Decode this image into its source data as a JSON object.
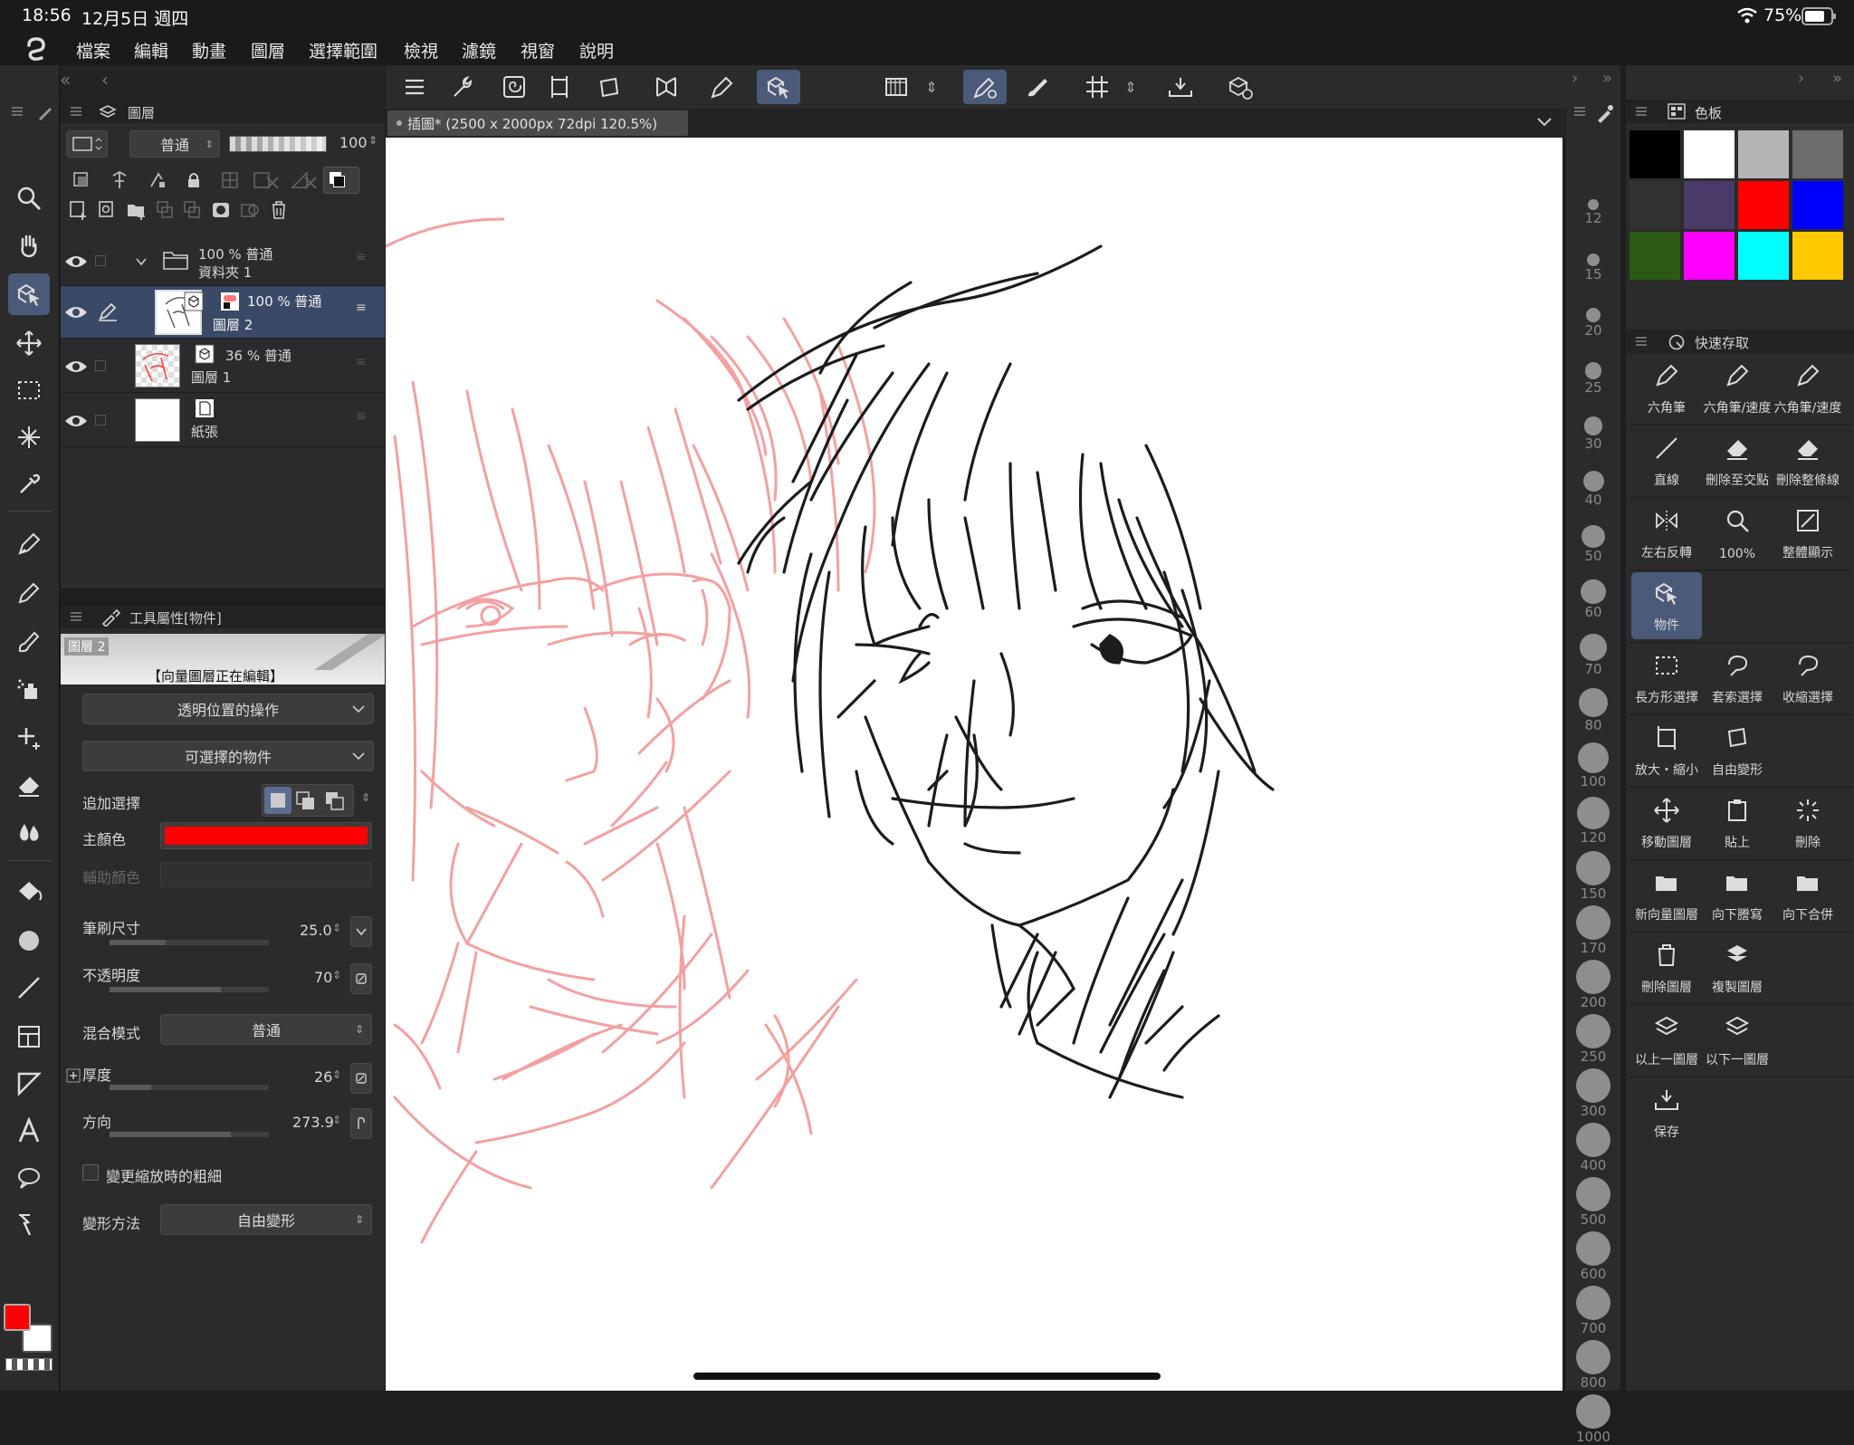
{
  "status": {
    "time": "18:56",
    "date": "12月5日 週四",
    "battery": "75%"
  },
  "menu": [
    "檔案",
    "編輯",
    "動畫",
    "圖層",
    "選擇範圍",
    "檢視",
    "濾鏡",
    "視窗",
    "說明"
  ],
  "layer_panel": {
    "title": "圖層",
    "blend_mode": "普通",
    "opacity": "100",
    "opacity_fraction": 1.0,
    "layers": [
      {
        "line1": "100 % 普通",
        "line2": "資料夾 1"
      },
      {
        "line1": "100 % 普通",
        "line2": "圖層 2"
      },
      {
        "line1": "36 % 普通",
        "line2": "圖層 1"
      },
      {
        "line1": "",
        "line2": "紙張"
      }
    ]
  },
  "tool_props": {
    "title": "工具屬性[物件]",
    "preview_layer": "圖層 2",
    "preview_caption": "【向量圖層正在編輯】",
    "dropdown1": "透明位置的操作",
    "dropdown2": "可選擇的物件",
    "add_select_label": "追加選擇",
    "main_color_label": "主顏色",
    "main_color": "#ff0000",
    "sub_color_label": "輔助顏色",
    "brush_size_label": "筆刷尺寸",
    "brush_size": "25.0",
    "brush_size_fraction": 0.35,
    "opacity_label": "不透明度",
    "opacity": "70",
    "opacity_fraction": 0.7,
    "blend_label": "混合模式",
    "blend": "普通",
    "thickness_label": "厚度",
    "thickness": "26",
    "thickness_fraction": 0.26,
    "direction_label": "方向",
    "direction": "273.9",
    "direction_fraction": 0.76,
    "checkbox_label": "變更縮放時的粗細",
    "transform_label": "變形方法",
    "transform": "自由變形"
  },
  "document_tab": "插圖* (2500 x 2000px 72dpi 120.5%)",
  "brush_sizes": [
    "12",
    "15",
    "20",
    "25",
    "30",
    "40",
    "50",
    "60",
    "70",
    "80",
    "100",
    "120",
    "150",
    "170",
    "200",
    "250",
    "300",
    "400",
    "500",
    "600",
    "700",
    "800",
    "1000"
  ],
  "color_set": {
    "title": "色板",
    "colors": [
      "#000000",
      "#ffffff",
      "#b4b4b4",
      "#6c6c6c",
      "#323232",
      "#4a3a6a",
      "#ff0000",
      "#0000ff",
      "#2b5a14",
      "#ff00ff",
      "#00ffff",
      "#ffc800"
    ]
  },
  "quick_access": {
    "title": "快速存取",
    "items": [
      "六角筆",
      "六角筆/速度",
      "六角筆/速度",
      "直線",
      "刪除至交點",
      "刪除整條線",
      "左右反轉",
      "100%",
      "整體顯示",
      "物件",
      "",
      "",
      "長方形選擇",
      "套索選擇",
      "收縮選擇",
      "放大・縮小",
      "自由變形",
      "",
      "移動圖層",
      "貼上",
      "刪除",
      "新向量圖層",
      "向下謄寫",
      "向下合併",
      "刪除圖層",
      "複製圖層",
      "",
      "以上一圖層",
      "以下一圖層",
      "",
      "保存",
      "",
      ""
    ]
  },
  "colors": {
    "accent": "#4a5a78",
    "primary_color": "#ff0000",
    "secondary_color": "#ffffff"
  }
}
